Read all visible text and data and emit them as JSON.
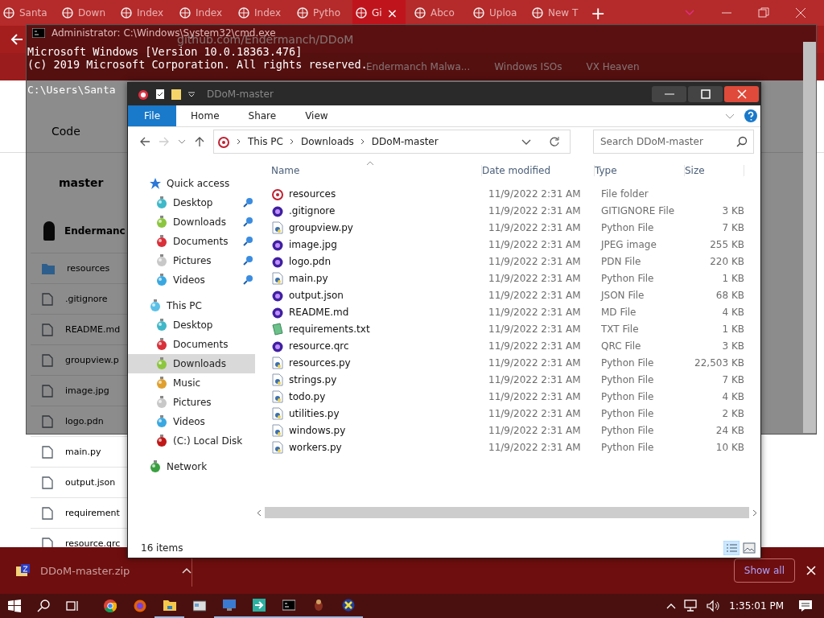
{
  "browser": {
    "tabs": [
      {
        "label": "Santa",
        "selected": false
      },
      {
        "label": "Down",
        "selected": false
      },
      {
        "label": "Index",
        "selected": false
      },
      {
        "label": "Index",
        "selected": false
      },
      {
        "label": "Index",
        "selected": false
      },
      {
        "label": "Pytho",
        "selected": false
      },
      {
        "label": "Gi",
        "selected": true
      },
      {
        "label": "Abco",
        "selected": false
      },
      {
        "label": "Uploa",
        "selected": false
      },
      {
        "label": "New T",
        "selected": false
      }
    ],
    "new_tab": "+",
    "close_tab": "×",
    "address": "github.com/Endermanch/DDoM",
    "bookmarks": [
      "Endermanch Malwa...",
      "Windows ISOs",
      "VX Heaven"
    ],
    "page": {
      "tab": "Code",
      "branch": "master",
      "author": "Endermanc",
      "files": [
        {
          "name": "resources",
          "kind": "folder"
        },
        {
          "name": ".gitignore",
          "kind": "file"
        },
        {
          "name": "README.md",
          "kind": "file"
        },
        {
          "name": "groupview.p",
          "kind": "file"
        },
        {
          "name": "image.jpg",
          "kind": "file"
        },
        {
          "name": "logo.pdn",
          "kind": "file"
        },
        {
          "name": "main.py",
          "kind": "file"
        },
        {
          "name": "output.json",
          "kind": "file"
        },
        {
          "name": "requirement",
          "kind": "file"
        },
        {
          "name": "resource.qrc",
          "kind": "file"
        }
      ]
    }
  },
  "console": {
    "title": "Administrator: C:\\Windows\\System32\\cmd.exe",
    "lines": [
      "Microsoft Windows [Version 10.0.18363.476]",
      "(c) 2019 Microsoft Corporation. All rights reserved.",
      "C:\\Users\\Santa"
    ]
  },
  "explorer": {
    "title": "DDoM-master",
    "ribbon_tabs": [
      {
        "label": "File",
        "selected": true
      },
      {
        "label": "Home",
        "selected": false
      },
      {
        "label": "Share",
        "selected": false
      },
      {
        "label": "View",
        "selected": false
      }
    ],
    "breadcrumb": [
      "This PC",
      "Downloads",
      "DDoM-master"
    ],
    "search": {
      "placeholder": "Search DDoM-master"
    },
    "nav": [
      {
        "label": "Quick access",
        "kind": "star",
        "children": [
          {
            "label": "Desktop",
            "color": "#3fb8c8",
            "pinned": true,
            "selected": false
          },
          {
            "label": "Downloads",
            "color": "#8cc63f",
            "pinned": true,
            "selected": false
          },
          {
            "label": "Documents",
            "color": "#d9303a",
            "pinned": true,
            "selected": false
          },
          {
            "label": "Pictures",
            "color": "#c8c8c8",
            "pinned": true,
            "selected": false
          },
          {
            "label": "Videos",
            "color": "#3aa8e0",
            "pinned": true,
            "selected": false
          }
        ]
      },
      {
        "label": "This PC",
        "kind": "pc",
        "children": [
          {
            "label": "Desktop",
            "color": "#3fb8c8",
            "pinned": false,
            "selected": false
          },
          {
            "label": "Documents",
            "color": "#d9303a",
            "pinned": false,
            "selected": false
          },
          {
            "label": "Downloads",
            "color": "#8cc63f",
            "pinned": false,
            "selected": true
          },
          {
            "label": "Music",
            "color": "#e0a030",
            "pinned": false,
            "selected": false
          },
          {
            "label": "Pictures",
            "color": "#c8c8c8",
            "pinned": false,
            "selected": false
          },
          {
            "label": "Videos",
            "color": "#3aa8e0",
            "pinned": false,
            "selected": false
          },
          {
            "label": "(C:) Local Disk",
            "color": "#c01818",
            "pinned": false,
            "selected": false
          }
        ]
      },
      {
        "label": "Network",
        "kind": "network"
      }
    ],
    "columns": [
      "Name",
      "Date modified",
      "Type",
      "Size"
    ],
    "files": [
      {
        "name": "resources",
        "kind": "folder",
        "date": "11/9/2022 2:31 AM",
        "type": "File folder"
      },
      {
        "name": ".gitignore",
        "kind": "ornament",
        "date": "11/9/2022 2:31 AM",
        "type": "GITIGNORE File",
        "size": "3 KB"
      },
      {
        "name": "groupview.py",
        "kind": "script",
        "date": "11/9/2022 2:31 AM",
        "type": "Python File",
        "size": "7 KB"
      },
      {
        "name": "image.jpg",
        "kind": "ornament",
        "date": "11/9/2022 2:31 AM",
        "type": "JPEG image",
        "size": "255 KB"
      },
      {
        "name": "logo.pdn",
        "kind": "ornament",
        "date": "11/9/2022 2:31 AM",
        "type": "PDN File",
        "size": "220 KB"
      },
      {
        "name": "main.py",
        "kind": "script",
        "date": "11/9/2022 2:31 AM",
        "type": "Python File",
        "size": "1 KB"
      },
      {
        "name": "output.json",
        "kind": "ornament",
        "date": "11/9/2022 2:31 AM",
        "type": "JSON File",
        "size": "68 KB"
      },
      {
        "name": "README.md",
        "kind": "ornament",
        "date": "11/9/2022 2:31 AM",
        "type": "MD File",
        "size": "4 KB"
      },
      {
        "name": "requirements.txt",
        "kind": "text",
        "date": "11/9/2022 2:31 AM",
        "type": "TXT File",
        "size": "1 KB"
      },
      {
        "name": "resource.qrc",
        "kind": "ornament",
        "date": "11/9/2022 2:31 AM",
        "type": "QRC File",
        "size": "3 KB"
      },
      {
        "name": "resources.py",
        "kind": "script",
        "date": "11/9/2022 2:31 AM",
        "type": "Python File",
        "size": "22,503 KB"
      },
      {
        "name": "strings.py",
        "kind": "script",
        "date": "11/9/2022 2:31 AM",
        "type": "Python File",
        "size": "7 KB"
      },
      {
        "name": "todo.py",
        "kind": "script",
        "date": "11/9/2022 2:31 AM",
        "type": "Python File",
        "size": "4 KB"
      },
      {
        "name": "utilities.py",
        "kind": "script",
        "date": "11/9/2022 2:31 AM",
        "type": "Python File",
        "size": "2 KB"
      },
      {
        "name": "windows.py",
        "kind": "script",
        "date": "11/9/2022 2:31 AM",
        "type": "Python File",
        "size": "24 KB"
      },
      {
        "name": "workers.py",
        "kind": "script",
        "date": "11/9/2022 2:31 AM",
        "type": "Python File",
        "size": "10 KB"
      }
    ],
    "status": "16 items"
  },
  "download_bar": {
    "file": "DDoM-master.zip",
    "show_all": "Show all"
  },
  "taskbar": {
    "clock": "1:35:01 PM",
    "apps": [
      {
        "kind": "chrome",
        "running": false
      },
      {
        "kind": "firefox",
        "running": false
      },
      {
        "kind": "folder",
        "running": true
      },
      {
        "kind": "window",
        "running": false
      },
      {
        "kind": "monitor",
        "running": true
      },
      {
        "kind": "arrow",
        "running": true
      },
      {
        "kind": "console",
        "running": true
      },
      {
        "kind": "bug",
        "running": true
      },
      {
        "kind": "cross",
        "running": true
      }
    ]
  }
}
